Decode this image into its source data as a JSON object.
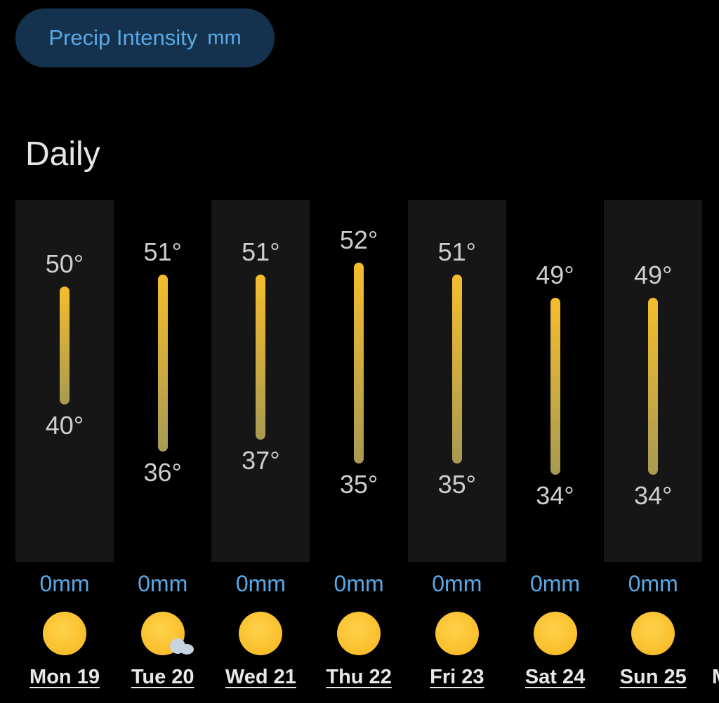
{
  "chip": {
    "label": "Precip Intensity",
    "unit": "mm"
  },
  "section_title": "Daily",
  "days": [
    {
      "day": "Mon 19",
      "high": "50°",
      "low": "40°",
      "high_val": 50,
      "low_val": 40,
      "precip": "0mm",
      "icon": "sun-icon"
    },
    {
      "day": "Tue 20",
      "high": "51°",
      "low": "36°",
      "high_val": 51,
      "low_val": 36,
      "precip": "0mm",
      "icon": "sun-with-small-cloud-icon"
    },
    {
      "day": "Wed 21",
      "high": "51°",
      "low": "37°",
      "high_val": 51,
      "low_val": 37,
      "precip": "0mm",
      "icon": "sun-icon"
    },
    {
      "day": "Thu 22",
      "high": "52°",
      "low": "35°",
      "high_val": 52,
      "low_val": 35,
      "precip": "0mm",
      "icon": "sun-icon"
    },
    {
      "day": "Fri 23",
      "high": "51°",
      "low": "35°",
      "high_val": 51,
      "low_val": 35,
      "precip": "0mm",
      "icon": "sun-icon"
    },
    {
      "day": "Sat 24",
      "high": "49°",
      "low": "34°",
      "high_val": 49,
      "low_val": 34,
      "precip": "0mm",
      "icon": "sun-icon"
    },
    {
      "day": "Sun 25",
      "high": "49°",
      "low": "34°",
      "high_val": 49,
      "low_val": 34,
      "precip": "0mm",
      "icon": "sun-icon"
    }
  ],
  "next_day_partial": "M",
  "colors": {
    "chip_bg": "#14324d",
    "accent": "#5aa9e6",
    "bar_top": "#f5bd2c",
    "bar_bottom": "#a89a52",
    "sun": "#f6b51e"
  }
}
